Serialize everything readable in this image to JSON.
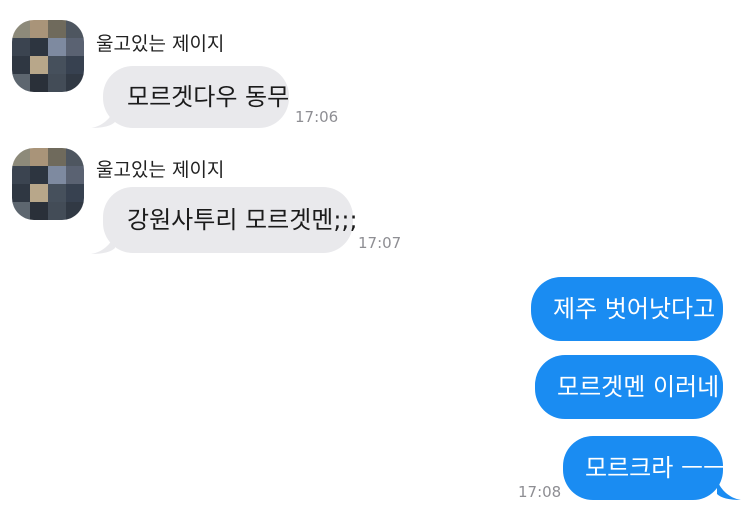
{
  "colors": {
    "incoming_bubble": "#e9e9ec",
    "outgoing_bubble": "#1a8cf2",
    "timestamp": "#8e8e93"
  },
  "messages": [
    {
      "direction": "incoming",
      "sender": "울고있는 제이지",
      "text": "모르겟다우 동무",
      "time": "17:06"
    },
    {
      "direction": "incoming",
      "sender": "울고있는 제이지",
      "text": "강원사투리 모르겟멘;;;",
      "time": "17:07"
    },
    {
      "direction": "outgoing",
      "text": "제주 벗어낫다고"
    },
    {
      "direction": "outgoing",
      "text": "모르겟멘 이러네"
    },
    {
      "direction": "outgoing",
      "text": "모르크라 ㅡㅡ",
      "time": "17:08"
    }
  ]
}
